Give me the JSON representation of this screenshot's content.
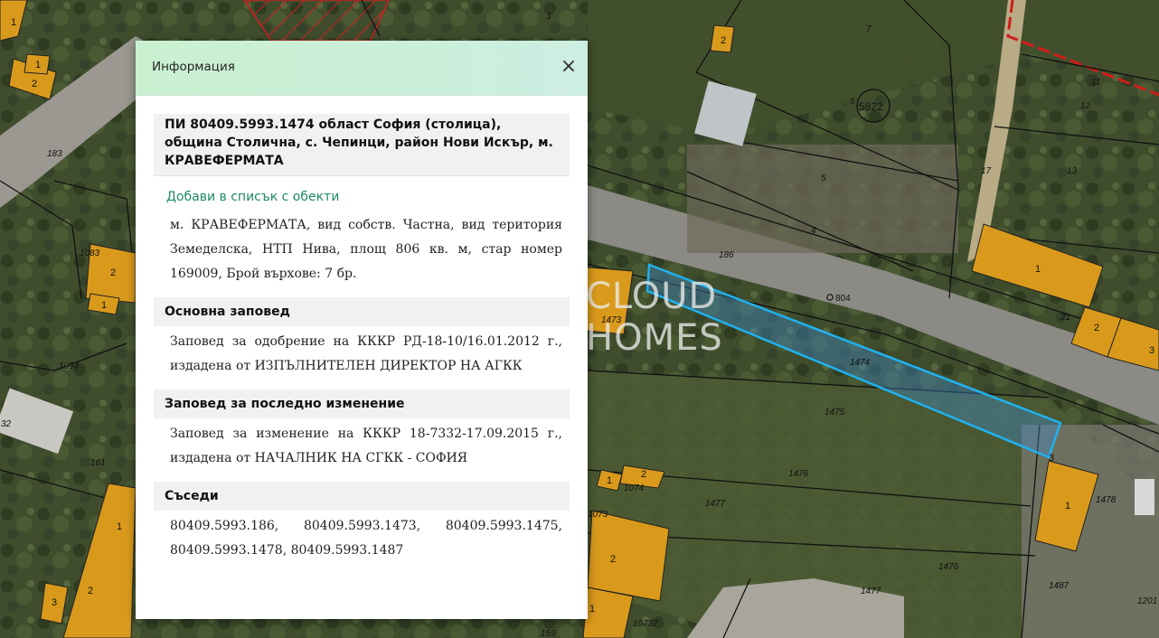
{
  "map": {
    "parcels": [
      "1473",
      "1474",
      "1475",
      "1476",
      "1477",
      "1476",
      "1477",
      "1478",
      "1487",
      "1083",
      "1094",
      "1073",
      "1074",
      "10737",
      "183",
      "186",
      "161",
      "159",
      "32",
      "1201",
      "4",
      "5",
      "6",
      "7",
      "11",
      "12",
      "13",
      "17",
      "3",
      "21"
    ],
    "buildings": [
      "1",
      "2",
      "3",
      "1",
      "2",
      "1",
      "2",
      "1",
      "2",
      "3",
      "1",
      "1",
      "2",
      "1",
      "2",
      "1",
      "2",
      "3"
    ],
    "survey_point": "804",
    "stamp": "5822"
  },
  "watermark": {
    "line1": "CLOUD",
    "line2": "HOMES"
  },
  "panel": {
    "title": "Информация",
    "close_label": "×",
    "heading": "ПИ 80409.5993.1474 област София (столица), община Столична, с. Чепинци, район Нови Искър, м. КРАВЕФЕРМАТА",
    "add_link": "Добави в списък с обекти",
    "description": "м. КРАВЕФЕРМАТА, вид собств. Частна, вид територия Земеделска, НТП Нива, площ 806 кв. м, стар номер 169009, Брой върхове: 7 бр.",
    "sections": [
      {
        "title": "Основна заповед",
        "text": "Заповед за одобрение на КККР РД-18-10/16.01.2012 г., издадена от ИЗПЪЛНИТЕЛЕН ДИРЕКТОР НА АГКК"
      },
      {
        "title": "Заповед за последно изменение",
        "text": "Заповед за изменение на КККР 18-7332-17.09.2015 г., издадена от НАЧАЛНИК НА СГКК - СОФИЯ"
      },
      {
        "title": "Съседи",
        "text": "80409.5993.186, 80409.5993.1473, 80409.5993.1475, 80409.5993.1478, 80409.5993.1487"
      }
    ]
  }
}
